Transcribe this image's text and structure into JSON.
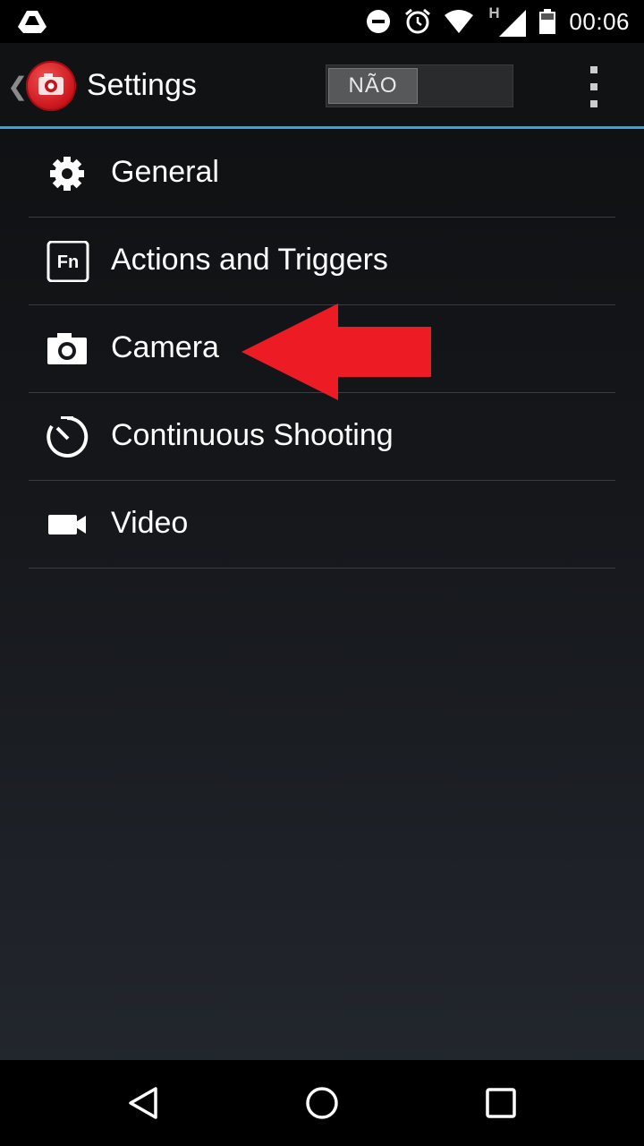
{
  "status_bar": {
    "time": "00:06",
    "signal_letter": "H",
    "icons": [
      "google-drive-icon",
      "do-not-disturb-icon",
      "alarm-icon",
      "wifi-icon",
      "cell-signal-icon",
      "battery-icon"
    ]
  },
  "action_bar": {
    "title": "Settings",
    "toggle_label": "NÃO",
    "accent_color": "#33a5dd",
    "logo_icon": "camera-app-logo"
  },
  "menu": {
    "items": [
      {
        "label": "General",
        "icon": "gear-icon"
      },
      {
        "label": "Actions and Triggers",
        "icon": "fn-key-icon"
      },
      {
        "label": "Camera",
        "icon": "camera-icon"
      },
      {
        "label": "Continuous Shooting",
        "icon": "timer-icon"
      },
      {
        "label": "Video",
        "icon": "video-camera-icon"
      }
    ]
  },
  "annotation": {
    "arrow_color": "#ed1c24",
    "points_to": "Camera"
  },
  "nav_bar": {
    "buttons": [
      "back-icon",
      "home-icon",
      "recents-icon"
    ]
  }
}
